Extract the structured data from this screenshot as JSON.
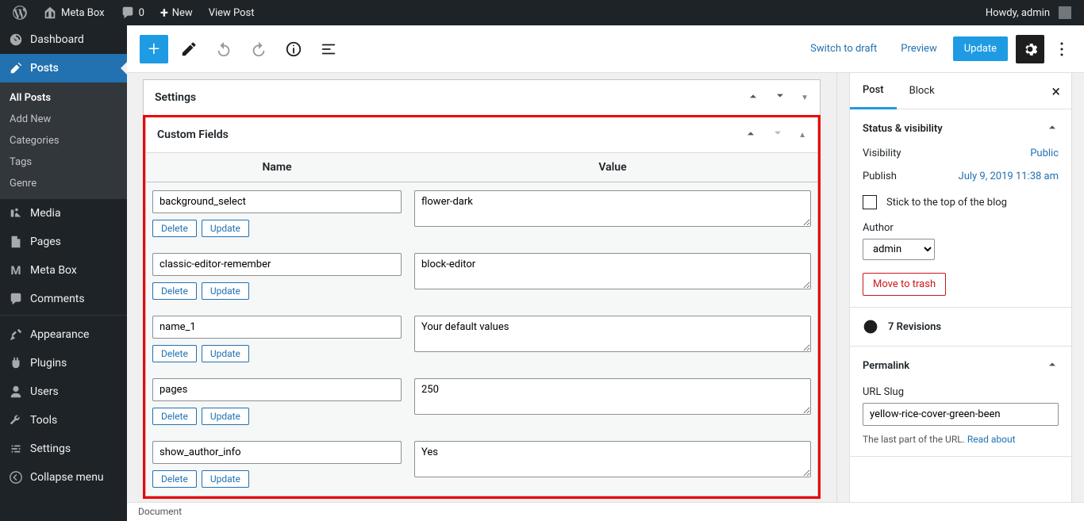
{
  "adminbar": {
    "site_name": "Meta Box",
    "comments": "0",
    "new": "New",
    "view_post": "View Post",
    "howdy": "Howdy, admin"
  },
  "sidebar": {
    "dashboard": "Dashboard",
    "posts": "Posts",
    "posts_sub": {
      "all": "All Posts",
      "add": "Add New",
      "cats": "Categories",
      "tags": "Tags",
      "genre": "Genre"
    },
    "media": "Media",
    "pages": "Pages",
    "metabox": "Meta Box",
    "comments": "Comments",
    "appearance": "Appearance",
    "plugins": "Plugins",
    "users": "Users",
    "tools": "Tools",
    "settings": "Settings",
    "collapse": "Collapse menu"
  },
  "toolbar": {
    "switch": "Switch to draft",
    "preview": "Preview",
    "update": "Update"
  },
  "panels": {
    "settings_title": "Settings",
    "cf_title": "Custom Fields",
    "name_col": "Name",
    "value_col": "Value",
    "delete": "Delete",
    "update": "Update"
  },
  "custom_fields": [
    {
      "name": "background_select",
      "value": "flower-dark"
    },
    {
      "name": "classic-editor-remember",
      "value": "block-editor"
    },
    {
      "name": "name_1",
      "value": "Your default values"
    },
    {
      "name": "pages",
      "value": "250"
    },
    {
      "name": "show_author_info",
      "value": "Yes"
    }
  ],
  "inspector": {
    "tab_post": "Post",
    "tab_block": "Block",
    "status_title": "Status & visibility",
    "visibility_label": "Visibility",
    "visibility_value": "Public",
    "publish_label": "Publish",
    "publish_value": "July 9, 2019 11:38 am",
    "stick": "Stick to the top of the blog",
    "author_label": "Author",
    "author_value": "admin",
    "trash": "Move to trash",
    "revisions": "7 Revisions",
    "permalink_title": "Permalink",
    "slug_label": "URL Slug",
    "slug_value": "yellow-rice-cover-green-been",
    "slug_help_1": "The last part of the URL. ",
    "slug_help_link": "Read about"
  },
  "footer": {
    "document": "Document"
  }
}
